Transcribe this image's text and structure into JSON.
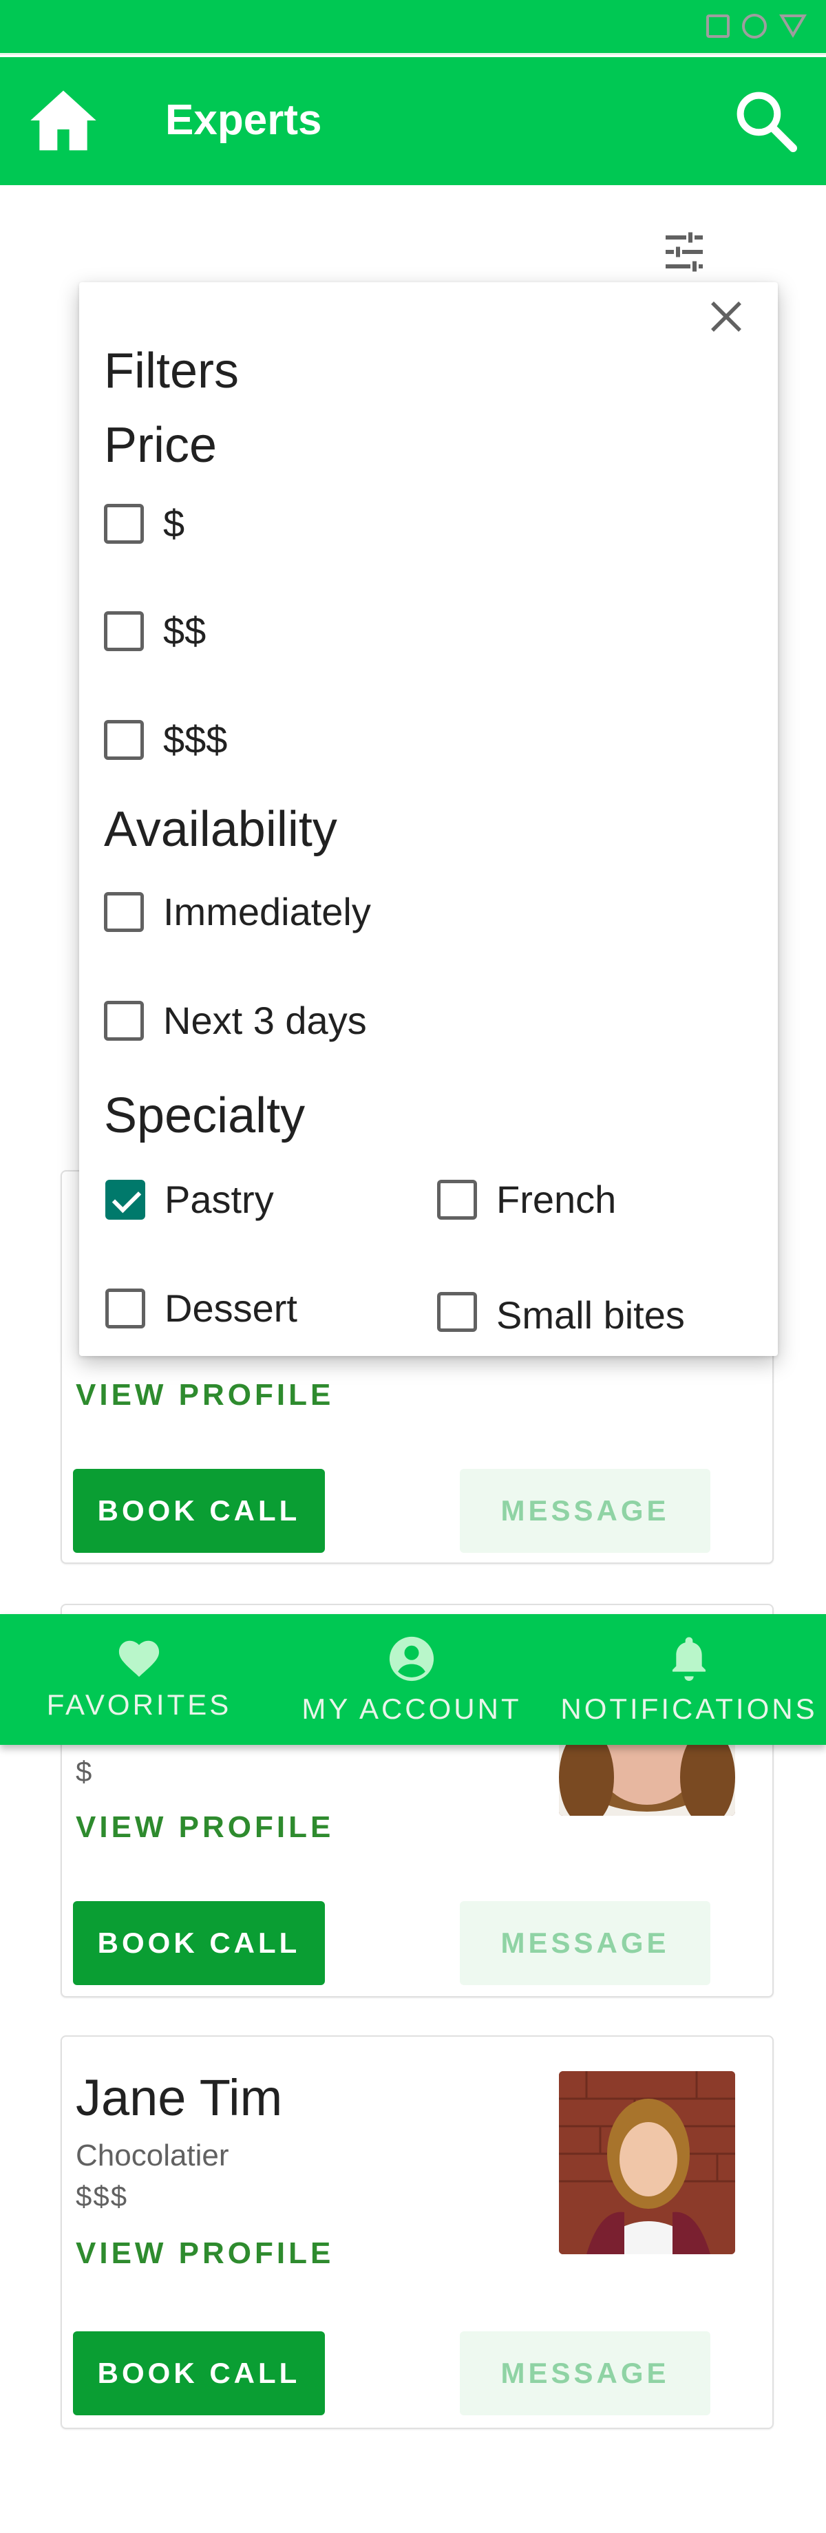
{
  "app_bar": {
    "title": "Experts"
  },
  "filters": {
    "title": "Filters",
    "price": {
      "heading": "Price",
      "options": [
        "$",
        "$$",
        "$$$"
      ]
    },
    "availability": {
      "heading": "Availability",
      "options": [
        "Immediately",
        "Next 3 days"
      ]
    },
    "specialty": {
      "heading": "Specialty",
      "options": [
        {
          "label": "Pastry",
          "checked": true
        },
        {
          "label": "French",
          "checked": false
        },
        {
          "label": "Dessert",
          "checked": false
        },
        {
          "label": "Small bites",
          "checked": false
        }
      ]
    }
  },
  "cards": [
    {
      "view_profile": "VIEW PROFILE",
      "book_call": "BOOK CALL",
      "message": "MESSAGE"
    },
    {
      "price": "$",
      "view_profile": "VIEW PROFILE",
      "book_call": "BOOK CALL",
      "message": "MESSAGE"
    },
    {
      "name": "Jane Tim",
      "specialty": "Chocolatier",
      "price": "$$$",
      "view_profile": "VIEW PROFILE",
      "book_call": "BOOK CALL",
      "message": "MESSAGE"
    }
  ],
  "bottom_nav": {
    "favorites": "FAVORITES",
    "my_account": "MY ACCOUNT",
    "notifications": "NOTIFICATIONS"
  },
  "icons": {
    "home": "home-icon",
    "search": "search-icon",
    "filter": "tune-icon",
    "close": "close-icon",
    "favorites": "heart-icon",
    "account": "account-circle-icon",
    "notifications": "bell-icon"
  },
  "colors": {
    "primary": "#00c853",
    "button": "#0a9e33",
    "link": "#2e8b2e",
    "message_bg": "#eef9f0",
    "message_text": "#8fd3a4",
    "checkbox_checked": "#00796b"
  }
}
